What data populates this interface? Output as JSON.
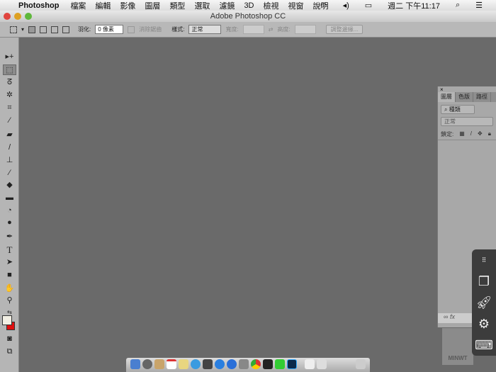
{
  "menubar": {
    "app": "Photoshop",
    "items": [
      "檔案",
      "編輯",
      "影像",
      "圖層",
      "類型",
      "選取",
      "濾鏡",
      "3D",
      "檢視",
      "視窗",
      "說明"
    ],
    "clock": "週二 下午11:17"
  },
  "window": {
    "title": "Adobe Photoshop CC"
  },
  "options": {
    "feather_label": "羽化:",
    "feather_value": "0 像素",
    "antialias_label": "消除鋸齒",
    "style_label": "樣式:",
    "style_value": "正常",
    "width_label": "寬度:",
    "height_label": "高度:",
    "refine_label": "調整邊緣..."
  },
  "tools": [
    "move",
    "marquee",
    "lasso",
    "magic-wand",
    "crop",
    "eyedropper",
    "healing",
    "brush",
    "stamp",
    "history-brush",
    "eraser",
    "gradient",
    "blur",
    "dodge",
    "pen",
    "type",
    "path-select",
    "shape",
    "hand",
    "zoom"
  ],
  "colors": {
    "foreground": "#f2efe4",
    "background": "#e01010"
  },
  "layers_panel": {
    "tabs": [
      "圖層",
      "色版",
      "路徑"
    ],
    "filter": "種類",
    "blend": "正常",
    "lock_label": "鎖定:"
  },
  "watermark": "MINWT"
}
